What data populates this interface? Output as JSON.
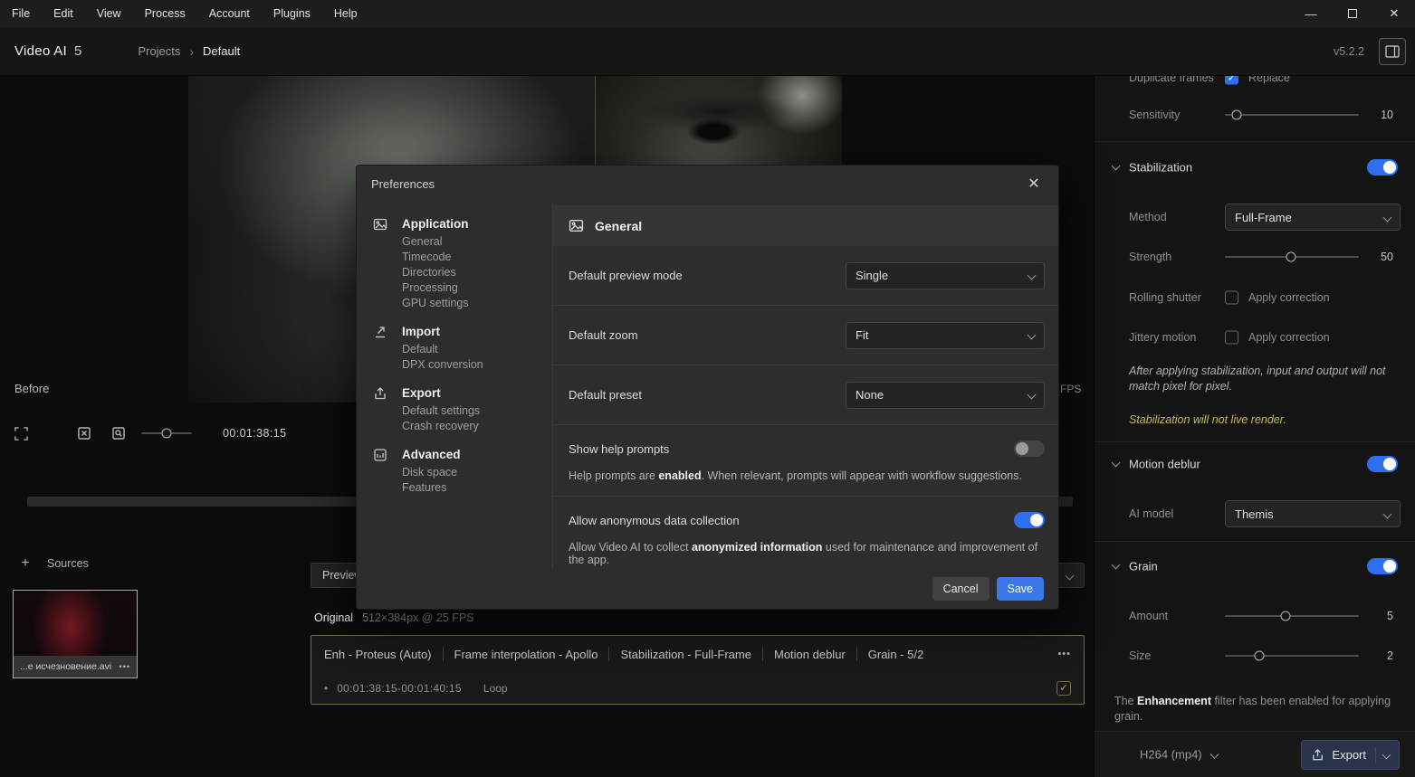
{
  "icons": {
    "minimize": "—",
    "close": "✕",
    "dialog_close": "✕",
    "breadcrumb_sep": "›",
    "more": "•••",
    "check": "✓",
    "plus": "+",
    "bullet": "•"
  },
  "menubar": {
    "items": [
      "File",
      "Edit",
      "View",
      "Process",
      "Account",
      "Plugins",
      "Help"
    ]
  },
  "appbar": {
    "title": "Video AI",
    "version_badge": "5",
    "breadcrumb_root": "Projects",
    "breadcrumb_current": "Default",
    "version": "v5.2.2"
  },
  "preview": {
    "before_label": "Before",
    "timecode": "00:01:38:15",
    "fps_label": "FPS",
    "mini_slider_percent": 50
  },
  "sources": {
    "title": "Sources",
    "clip_name": "...е исчезновение.avi"
  },
  "bottom": {
    "preview_button": "Preview",
    "original_label": "Original",
    "original_info": "512×384px @ 25 FPS",
    "filters": [
      "Enh - Proteus (Auto)",
      "Frame interpolation - Apollo",
      "Stabilization - Full-Frame",
      "Motion deblur",
      "Grain - 5/2"
    ],
    "clip_range": "00:01:38:15-00:01:40:15",
    "loop_label": "Loop"
  },
  "dialog": {
    "title": "Preferences",
    "nav": [
      {
        "label": "Application",
        "children": [
          "General",
          "Timecode",
          "Directories",
          "Processing",
          "GPU settings"
        ]
      },
      {
        "label": "Import",
        "children": [
          "Default",
          "DPX conversion"
        ]
      },
      {
        "label": "Export",
        "children": [
          "Default settings",
          "Crash recovery"
        ]
      },
      {
        "label": "Advanced",
        "children": [
          "Disk space",
          "Features"
        ]
      }
    ],
    "section_title": "General",
    "rows": [
      {
        "label": "Default preview mode",
        "value": "Single"
      },
      {
        "label": "Default zoom",
        "value": "Fit"
      },
      {
        "label": "Default preset",
        "value": "None"
      }
    ],
    "help_prompts": {
      "label": "Show help prompts",
      "enabled": false,
      "desc_prefix": "Help prompts are ",
      "desc_bold": "enabled",
      "desc_suffix": ". When relevant, prompts will appear with workflow suggestions."
    },
    "data_collection": {
      "label": "Allow anonymous data collection",
      "enabled": true,
      "desc_prefix": "Allow Video AI to collect ",
      "desc_bold": "anonymized information",
      "desc_suffix": " used for maintenance and improvement of the app."
    },
    "cancel_label": "Cancel",
    "save_label": "Save"
  },
  "right_panel": {
    "duplicate_frames": {
      "label": "Duplicate frames",
      "replace_label": "Replace",
      "checked": true
    },
    "sensitivity": {
      "label": "Sensitivity",
      "value": 10,
      "percent": 9
    },
    "stabilization": {
      "title": "Stabilization",
      "enabled": true,
      "method_label": "Method",
      "method_value": "Full-Frame",
      "strength_label": "Strength",
      "strength_value": 50,
      "strength_percent": 49,
      "rolling_shutter_label": "Rolling shutter",
      "rolling_shutter_checkbox": "Apply correction",
      "jittery_motion_label": "Jittery motion",
      "jittery_motion_checkbox": "Apply correction",
      "note": "After applying stabilization, input and output will not match pixel for pixel.",
      "warning": "Stabilization will not live render."
    },
    "motion_deblur": {
      "title": "Motion deblur",
      "enabled": true,
      "ai_model_label": "AI model",
      "ai_model_value": "Themis"
    },
    "grain": {
      "title": "Grain",
      "enabled": true,
      "amount_label": "Amount",
      "amount_value": 5,
      "amount_percent": 45,
      "size_label": "Size",
      "size_value": 2,
      "size_percent": 26
    },
    "note_prefix": "The ",
    "note_bold": "Enhancement",
    "note_suffix": " filter has been enabled for applying grain."
  },
  "export_bar": {
    "format": "H264 (mp4)",
    "export_label": "Export"
  }
}
